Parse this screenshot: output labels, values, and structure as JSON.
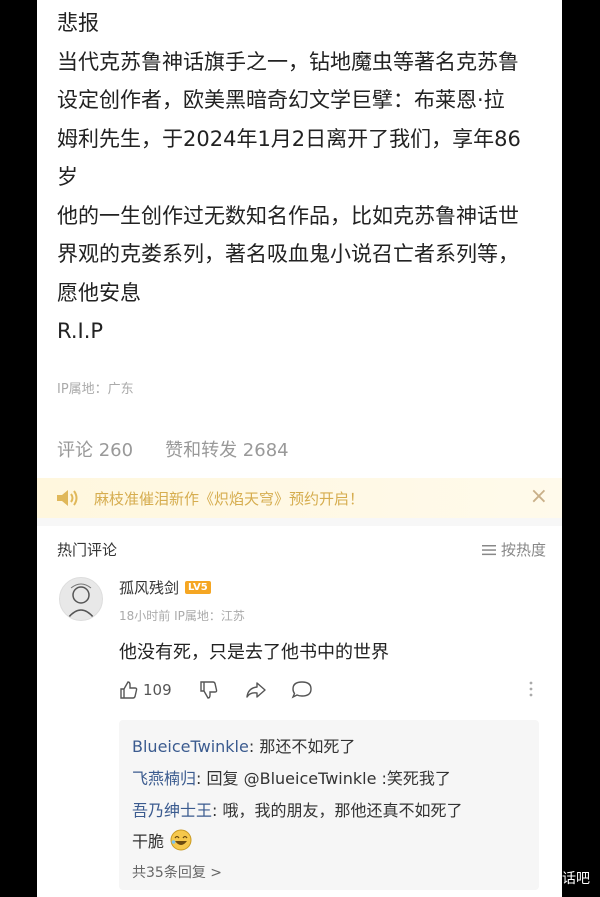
{
  "post": {
    "lines": [
      "悲报",
      "当代克苏鲁神话旗手之一，钻地魔虫等著名克苏鲁",
      "设定创作者，欧美黑暗奇幻文学巨擘：布莱恩·拉",
      "姆利先生，于2024年1月2日离开了我们，享年86",
      "岁",
      "他的一生创作过无数知名作品，比如克苏鲁神话世",
      "界观的克娄系列，著名吸血鬼小说召亡者系列等，",
      "愿他安息",
      "R.I.P"
    ],
    "ip_location": "IP属地：广东"
  },
  "stats": {
    "comments": "评论 260",
    "likes_reposts": "赞和转发 2684"
  },
  "banner": {
    "text": "麻枝准催泪新作《炽焰天穹》预约开启！",
    "close": "×",
    "accent": "#d6ad4f"
  },
  "comments_header": {
    "title": "热门评论",
    "sort_label": "按热度"
  },
  "comment": {
    "username": "孤风残剑",
    "level": "LV5",
    "time": "18小时前",
    "ip": "IP属地：江苏",
    "text": "他没有死，只是去了他书中的世界",
    "like_count": "109",
    "link_color": "#3b5b8f"
  },
  "replies": [
    {
      "name": "BlueiceTwinkle",
      "sep": ": ",
      "text": "那还不如死了"
    },
    {
      "name": "飞燕楠归",
      "sep": ": ",
      "text": "回复 @BlueiceTwinkle :笑死我了"
    },
    {
      "name": "吾乃绅士王",
      "sep": ": ",
      "text": "哦，我的朋友，那他还真不如死了"
    }
  ],
  "reply_continuation": "干脆",
  "replies_more": "共35条回复 >",
  "watermark": "话吧"
}
